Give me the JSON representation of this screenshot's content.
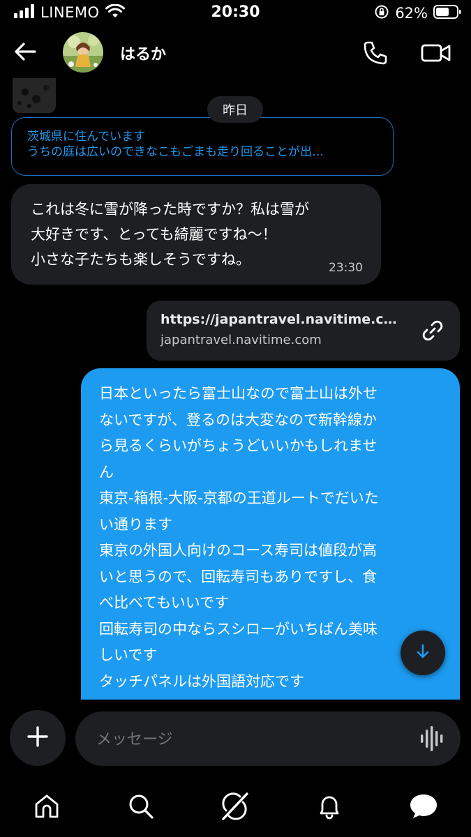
{
  "status_bar": {
    "carrier": "LINEMO",
    "time": "20:30",
    "battery": "62%"
  },
  "header": {
    "contact_name": "はるか"
  },
  "conversation": {
    "date_separator": "昨日",
    "reply_preview": {
      "line1": "茨城県に住んでいます",
      "line2": "うちの庭は広いのできなこもごまも走り回ることが出…"
    },
    "incoming_message": {
      "text": "これは冬に雪が降った時ですか？私は雪が\n大好きです、とっても綺麗ですね〜！\n小さな子たちも楽しそうですね。",
      "time": "23:30"
    },
    "link_card": {
      "title": "https://japantravel.navitime.co...",
      "domain": "japantravel.navitime.com"
    },
    "outgoing_message": {
      "text": "日本といったら富士山なので富士山は外せ\nないですが、登るのは大変なので新幹線か\nら見るくらいがちょうどいいかもしれませ\nん\n東京-箱根-大阪-京都の王道ルートでだいた\nい通ります\n東京の外国人向けのコース寿司は値段が高\nいと思うので、回転寿司もありですし、食\nべ比べてもいいです\n回転寿司の中ならスシローがいちばん美味\nしいです\nタッチパネルは外国語対応です"
    }
  },
  "composer": {
    "placeholder": "メッセージ"
  },
  "icons": {
    "back": "arrow-left-icon",
    "call": "phone-icon",
    "video": "video-camera-icon",
    "link": "link-icon",
    "scroll_down": "arrow-down-icon",
    "add": "plus-icon",
    "voice": "waveform-icon",
    "tabs": [
      "home-icon",
      "search-icon",
      "grok-icon",
      "bell-icon",
      "messages-icon"
    ]
  },
  "colors": {
    "accent": "#1d9bf0",
    "bubble_dark": "#1e1f22",
    "background": "#000000"
  }
}
